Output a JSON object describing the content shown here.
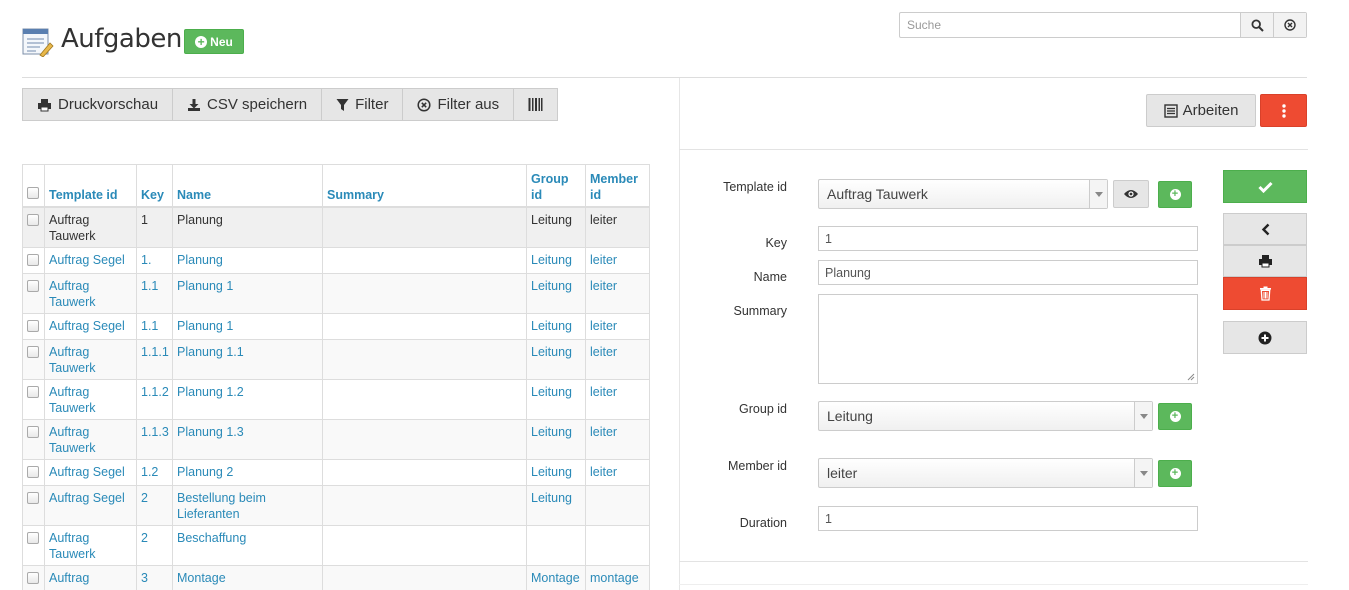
{
  "header": {
    "title": "Aufgaben",
    "new_label": "Neu",
    "search_placeholder": "Suche"
  },
  "toolbar": {
    "print_label": "Druckvorschau",
    "csv_label": "CSV speichern",
    "filter_label": "Filter",
    "filter_off_label": "Filter aus"
  },
  "table": {
    "headers": {
      "template_id": "Template id",
      "key": "Key",
      "name": "Name",
      "summary": "Summary",
      "group_id": "Group id",
      "member_id": "Member id"
    },
    "rows": [
      {
        "template_id": "Auftrag Tauwerk",
        "key": "1",
        "name": "Planung",
        "summary": "",
        "group_id": "Leitung",
        "member_id": "leiter"
      },
      {
        "template_id": "Auftrag Segel",
        "key": "1.",
        "name": "Planung",
        "summary": "",
        "group_id": "Leitung",
        "member_id": "leiter"
      },
      {
        "template_id": "Auftrag Tauwerk",
        "key": "1.1",
        "name": "Planung 1",
        "summary": "",
        "group_id": "Leitung",
        "member_id": "leiter"
      },
      {
        "template_id": "Auftrag Segel",
        "key": "1.1",
        "name": "Planung 1",
        "summary": "",
        "group_id": "Leitung",
        "member_id": "leiter"
      },
      {
        "template_id": "Auftrag Tauwerk",
        "key": "1.1.1",
        "name": "Planung 1.1",
        "summary": "",
        "group_id": "Leitung",
        "member_id": "leiter"
      },
      {
        "template_id": "Auftrag Tauwerk",
        "key": "1.1.2",
        "name": "Planung 1.2",
        "summary": "",
        "group_id": "Leitung",
        "member_id": "leiter"
      },
      {
        "template_id": "Auftrag Tauwerk",
        "key": "1.1.3",
        "name": "Planung 1.3",
        "summary": "",
        "group_id": "Leitung",
        "member_id": "leiter"
      },
      {
        "template_id": "Auftrag Segel",
        "key": "1.2",
        "name": "Planung 2",
        "summary": "",
        "group_id": "Leitung",
        "member_id": "leiter"
      },
      {
        "template_id": "Auftrag Segel",
        "key": "2",
        "name": "Bestellung beim Lieferanten",
        "summary": "",
        "group_id": "Leitung",
        "member_id": ""
      },
      {
        "template_id": "Auftrag Tauwerk",
        "key": "2",
        "name": "Beschaffung",
        "summary": "",
        "group_id": "",
        "member_id": ""
      },
      {
        "template_id": "Auftrag",
        "key": "3",
        "name": "Montage",
        "summary": "",
        "group_id": "Montage",
        "member_id": "montage"
      }
    ]
  },
  "detail": {
    "arbeiten_label": "Arbeiten",
    "labels": {
      "template_id": "Template id",
      "key": "Key",
      "name": "Name",
      "summary": "Summary",
      "group_id": "Group id",
      "member_id": "Member id",
      "duration": "Duration"
    },
    "values": {
      "template_id": "Auftrag Tauwerk",
      "key": "1",
      "name": "Planung",
      "summary": "",
      "group_id": "Leitung",
      "member_id": "leiter",
      "duration": "1"
    }
  },
  "colors": {
    "accent_link": "#2a8ab8",
    "success": "#5cb85c",
    "danger": "#ee4b32",
    "button_gray": "#e6e6e6"
  },
  "icons": [
    "tasklist-icon",
    "plus-circle-icon",
    "search-icon",
    "close-circle-icon",
    "print-icon",
    "download-icon",
    "filter-icon",
    "columns-icon",
    "list-icon",
    "vertical-dots-icon",
    "eye-icon",
    "check-icon",
    "chevron-left-icon",
    "trash-icon"
  ]
}
